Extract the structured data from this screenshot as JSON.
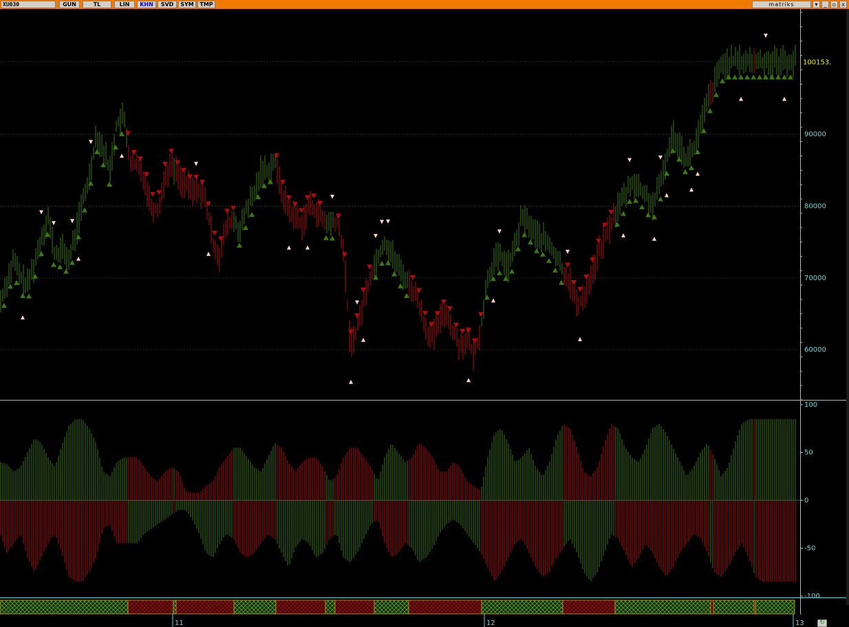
{
  "toolbar": {
    "symbol": "XU030",
    "buttons": [
      "GUN",
      "TL",
      "LIN",
      "KHN",
      "SVD",
      "SYM",
      "TMP"
    ],
    "active": "KHN",
    "logo": "matriks",
    "window_controls": [
      "▾",
      "_",
      "▫",
      "x"
    ]
  },
  "colors": {
    "bull": "#3a7a10",
    "bull_bright": "#33dd22",
    "bear": "#b00c0c",
    "signal_up": "#ffd4c4",
    "axis": "#6fd4d4",
    "last_price": "#f2f200",
    "title_bar": "#f07a00"
  },
  "chart_data": [
    {
      "type": "line",
      "title": "XU030",
      "last_price_label": "100153.",
      "y_ticks": [
        "90000",
        "80000",
        "70000",
        "60000"
      ],
      "ylim": [
        53000,
        107000
      ],
      "x_tick_labels": [
        "11",
        "12",
        "13"
      ],
      "x": [
        0,
        10,
        20,
        30,
        40,
        50,
        60,
        70,
        80,
        90,
        100,
        110,
        120,
        130,
        140,
        150,
        160,
        170,
        180,
        190,
        200,
        210,
        220,
        230,
        240,
        250,
        260,
        270,
        280,
        290,
        300,
        310,
        320,
        330,
        340,
        350,
        360,
        370,
        380,
        390,
        400,
        410,
        420,
        430,
        440,
        450,
        460,
        470,
        480,
        490,
        500,
        510,
        520,
        530,
        540,
        550,
        560,
        570,
        580,
        590,
        600,
        610,
        620,
        630,
        640,
        650,
        660,
        670,
        680,
        690,
        700,
        710,
        720,
        730,
        740,
        750,
        760,
        770,
        780,
        790,
        800,
        810,
        820,
        830,
        840,
        850,
        860,
        870,
        880,
        890,
        900,
        910,
        920,
        930,
        940,
        950,
        960,
        970,
        980,
        990,
        1000,
        1010,
        1020,
        1030,
        1040,
        1050,
        1060,
        1070,
        1080,
        1090,
        1100,
        1110,
        1120,
        1130,
        1140,
        1150,
        1160
      ],
      "series": [
        {
          "name": "XU030",
          "values": [
            66500,
            69500,
            72500,
            70000,
            69000,
            72000,
            75500,
            78500,
            73000,
            74000,
            72500,
            76000,
            80500,
            84000,
            90000,
            88000,
            85000,
            91500,
            92500,
            86000,
            85500,
            84000,
            80000,
            79500,
            84000,
            86000,
            84000,
            83000,
            82000,
            82500,
            80500,
            75000,
            73000,
            77500,
            78000,
            76500,
            80000,
            81500,
            85000,
            85000,
            86500,
            82000,
            79500,
            78500,
            77500,
            80000,
            79500,
            78000,
            77500,
            78000,
            74000,
            60500,
            63000,
            67000,
            70500,
            73000,
            75000,
            73500,
            71500,
            70000,
            68500,
            66500,
            63000,
            61500,
            64000,
            65500,
            62500,
            60500,
            61500,
            59000,
            63000,
            70000,
            72500,
            73000,
            71500,
            74500,
            78500,
            77500,
            76000,
            75500,
            74500,
            73000,
            71000,
            69500,
            66000,
            67500,
            70000,
            73000,
            75500,
            77500,
            80000,
            81500,
            83500,
            82500,
            81500,
            80000,
            82500,
            86500,
            90000,
            88500,
            86500,
            88000,
            91000,
            94500,
            97000,
            99500,
            100153,
            100153,
            100153,
            100153,
            100153,
            100153,
            100153,
            100153,
            100153,
            100153,
            100153
          ]
        }
      ]
    },
    {
      "type": "bar",
      "y_ticks": [
        "100",
        "50",
        "0",
        "-50",
        "-100"
      ],
      "ylim": [
        -100,
        100
      ],
      "x": [
        0,
        10,
        20,
        30,
        40,
        50,
        60,
        70,
        80,
        90,
        100,
        110,
        120,
        130,
        140,
        150,
        160,
        170,
        180,
        190,
        200,
        210,
        220,
        230,
        240,
        250,
        260,
        270,
        280,
        290,
        300,
        310,
        320,
        330,
        340,
        350,
        360,
        370,
        380,
        390,
        400,
        410,
        420,
        430,
        440,
        450,
        460,
        470,
        480,
        490,
        500,
        510,
        520,
        530,
        540,
        550,
        560,
        570,
        580,
        590,
        600,
        610,
        620,
        630,
        640,
        650,
        660,
        670,
        680,
        690,
        700,
        710,
        720,
        730,
        740,
        750,
        760,
        770,
        780,
        790,
        800,
        810,
        820,
        830,
        840,
        850,
        860,
        870,
        880,
        890,
        900,
        910,
        920,
        930,
        940,
        950,
        960,
        970,
        980,
        990,
        1000,
        1010,
        1020,
        1030,
        1040,
        1050,
        1060,
        1070,
        1080,
        1090,
        1100,
        1110,
        1120,
        1130,
        1140,
        1150,
        1160
      ],
      "series": [
        {
          "name": "upper",
          "values": [
            40,
            38,
            30,
            35,
            50,
            65,
            60,
            45,
            35,
            58,
            78,
            85,
            85,
            75,
            60,
            30,
            25,
            40,
            45,
            45,
            45,
            35,
            25,
            20,
            30,
            35,
            30,
            10,
            8,
            8,
            15,
            20,
            35,
            45,
            55,
            55,
            45,
            35,
            30,
            45,
            60,
            55,
            40,
            30,
            40,
            45,
            45,
            35,
            20,
            25,
            45,
            55,
            55,
            45,
            35,
            20,
            45,
            60,
            50,
            40,
            45,
            60,
            55,
            45,
            30,
            30,
            40,
            35,
            20,
            15,
            10,
            45,
            70,
            75,
            60,
            40,
            45,
            55,
            35,
            25,
            40,
            65,
            80,
            75,
            55,
            30,
            25,
            35,
            60,
            80,
            75,
            55,
            45,
            40,
            55,
            75,
            80,
            70,
            55,
            40,
            25,
            35,
            50,
            60,
            45,
            25,
            35,
            60,
            80,
            85,
            85,
            85,
            85,
            85,
            85,
            85,
            85
          ]
        },
        {
          "name": "lower",
          "values": [
            -35,
            -55,
            -45,
            -35,
            -60,
            -75,
            -60,
            -45,
            -35,
            -55,
            -80,
            -85,
            -85,
            -75,
            -60,
            -30,
            -25,
            -45,
            -45,
            -45,
            -45,
            -35,
            -30,
            -25,
            -20,
            -15,
            -10,
            -10,
            -20,
            -35,
            -55,
            -60,
            -45,
            -35,
            -40,
            -55,
            -60,
            -55,
            -45,
            -35,
            -40,
            -55,
            -70,
            -50,
            -40,
            -45,
            -60,
            -55,
            -40,
            -35,
            -60,
            -65,
            -55,
            -40,
            -25,
            -20,
            -45,
            -60,
            -55,
            -45,
            -50,
            -65,
            -60,
            -50,
            -35,
            -25,
            -20,
            -25,
            -35,
            -45,
            -55,
            -70,
            -85,
            -75,
            -60,
            -45,
            -40,
            -55,
            -70,
            -80,
            -75,
            -60,
            -50,
            -40,
            -55,
            -75,
            -85,
            -75,
            -55,
            -35,
            -40,
            -55,
            -70,
            -60,
            -45,
            -55,
            -70,
            -80,
            -70,
            -55,
            -45,
            -35,
            -40,
            -55,
            -75,
            -80,
            -70,
            -55,
            -45,
            -60,
            -80,
            -85,
            -85,
            -85,
            -85,
            -85,
            -85
          ]
        }
      ]
    },
    {
      "type": "table",
      "name": "regime strip",
      "x_tick_labels": [
        "11",
        "12",
        "13"
      ],
      "segments": [
        {
          "start": 0,
          "end": 186,
          "state": "bull"
        },
        {
          "start": 186,
          "end": 252,
          "state": "bear"
        },
        {
          "start": 252,
          "end": 256,
          "state": "bull"
        },
        {
          "start": 256,
          "end": 340,
          "state": "bear"
        },
        {
          "start": 340,
          "end": 401,
          "state": "bull"
        },
        {
          "start": 401,
          "end": 473,
          "state": "bear"
        },
        {
          "start": 473,
          "end": 487,
          "state": "bull"
        },
        {
          "start": 487,
          "end": 544,
          "state": "bear"
        },
        {
          "start": 544,
          "end": 594,
          "state": "bull"
        },
        {
          "start": 594,
          "end": 700,
          "state": "bear"
        },
        {
          "start": 700,
          "end": 818,
          "state": "bull"
        },
        {
          "start": 818,
          "end": 894,
          "state": "bear"
        },
        {
          "start": 894,
          "end": 1033,
          "state": "bull"
        },
        {
          "start": 1033,
          "end": 1037,
          "state": "bear"
        },
        {
          "start": 1037,
          "end": 1096,
          "state": "bull"
        },
        {
          "start": 1096,
          "end": 1098,
          "state": "bear"
        },
        {
          "start": 1098,
          "end": 1155,
          "state": "bull"
        }
      ]
    }
  ]
}
